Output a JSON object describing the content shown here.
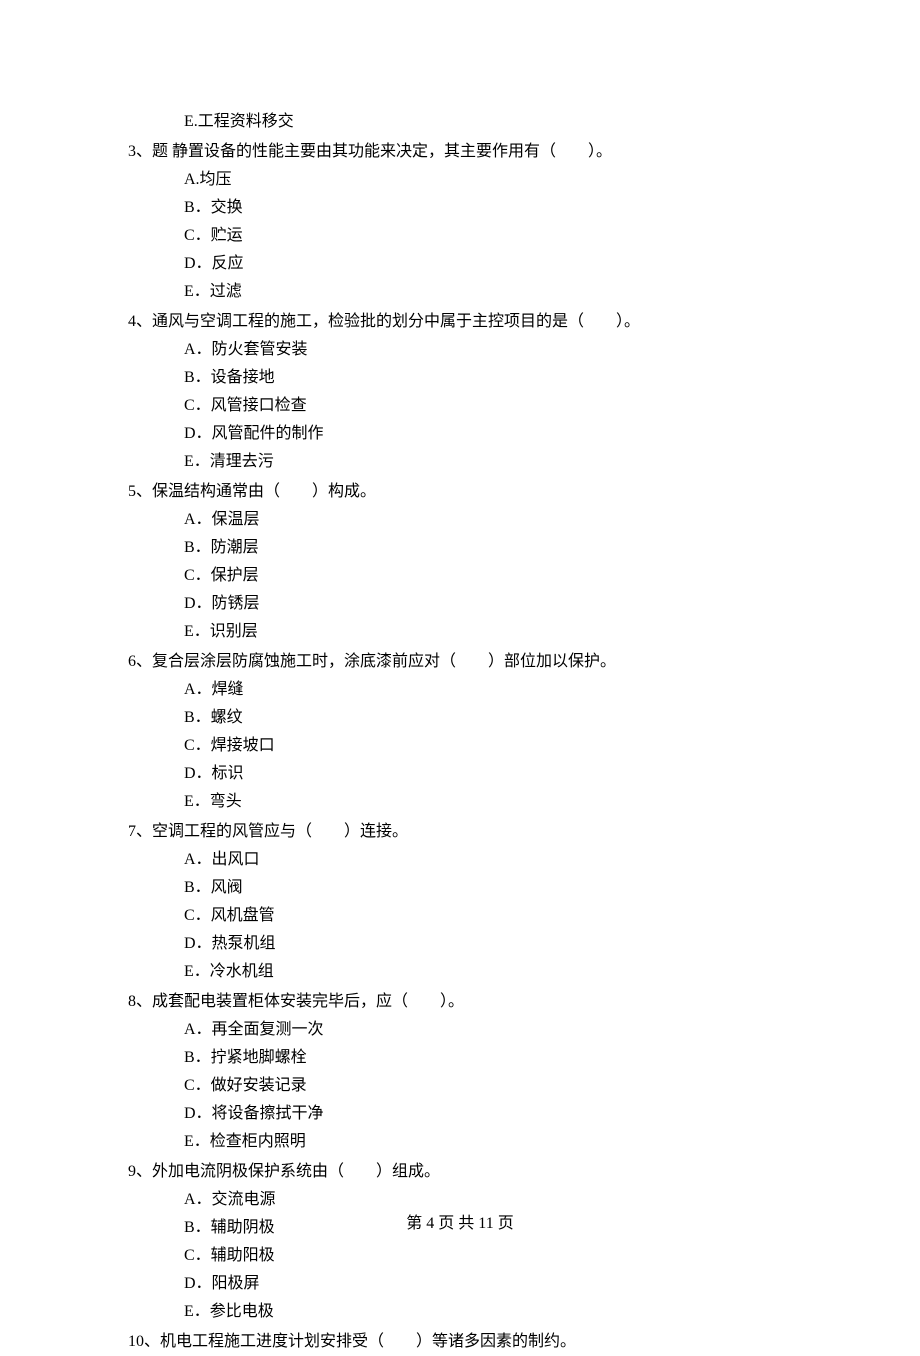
{
  "carry_over_option": "E.工程资料移交",
  "questions": [
    {
      "number": "3、",
      "stem": "题 静置设备的性能主要由其功能来决定，其主要作用有（　　）。",
      "options": [
        "A.均压",
        "B．交换",
        "C．贮运",
        "D．反应",
        "E．过滤"
      ]
    },
    {
      "number": "4、",
      "stem": "通风与空调工程的施工，检验批的划分中属于主控项目的是（　　）。",
      "options": [
        "A．防火套管安装",
        "B．设备接地",
        "C．风管接口检查",
        "D．风管配件的制作",
        "E．清理去污"
      ]
    },
    {
      "number": "5、",
      "stem": "保温结构通常由（　　）构成。",
      "options": [
        "A．保温层",
        "B．防潮层",
        "C．保护层",
        "D．防锈层",
        "E．识别层"
      ]
    },
    {
      "number": "6、",
      "stem": "复合层涂层防腐蚀施工时，涂底漆前应对（　　）部位加以保护。",
      "options": [
        "A．焊缝",
        "B．螺纹",
        "C．焊接坡口",
        "D．标识",
        "E．弯头"
      ]
    },
    {
      "number": "7、",
      "stem": "空调工程的风管应与（　　）连接。",
      "options": [
        "A．出风口",
        "B．风阀",
        "C．风机盘管",
        "D．热泵机组",
        "E．冷水机组"
      ]
    },
    {
      "number": "8、",
      "stem": "成套配电装置柜体安装完毕后，应（　　）。",
      "options": [
        "A．再全面复测一次",
        "B．拧紧地脚螺栓",
        "C．做好安装记录",
        "D．将设备擦拭干净",
        "E．检查柜内照明"
      ]
    },
    {
      "number": "9、",
      "stem": "外加电流阴极保护系统由（　　）组成。",
      "options": [
        "A．交流电源",
        "B．辅助阴极",
        "C．辅助阳极",
        "D．阳极屏",
        "E．参比电极"
      ]
    },
    {
      "number": "10、",
      "stem": "机电工程施工进度计划安排受（　　）等诸多因素的制约。",
      "options": []
    }
  ],
  "footer": "第 4 页 共 11 页"
}
